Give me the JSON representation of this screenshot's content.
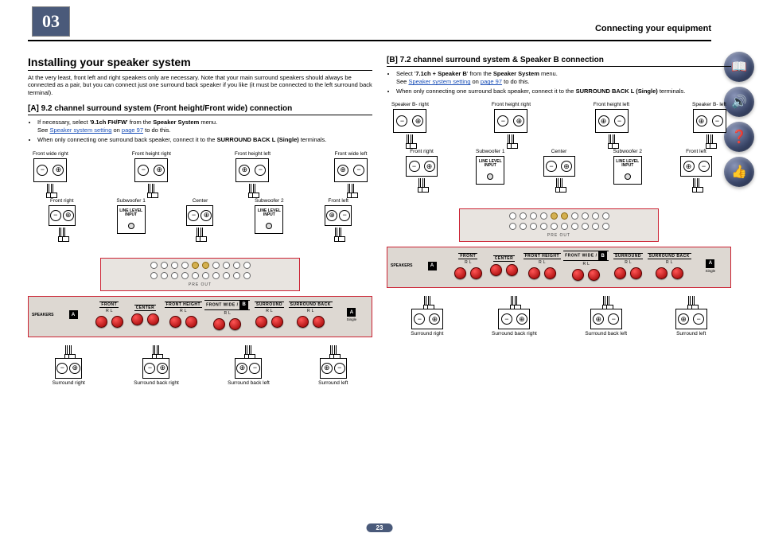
{
  "chapter": "03",
  "header": "Connecting your equipment",
  "page_number": "23",
  "side_icons": [
    "book-icon",
    "speaker-icon",
    "help-icon",
    "thumbs-up-icon"
  ],
  "left": {
    "title": "Installing your speaker system",
    "intro": "At the very least, front left and right speakers only are necessary. Note that your main surround speakers should always be connected as a pair, but you can connect just one surround back speaker if you like (it must be connected to the left surround back terminal).",
    "section_title": "[A] 9.2 channel surround system (Front height/Front wide) connection",
    "bullet1_pre": "If necessary, select '",
    "bullet1_bold1": "9.1ch FH/FW",
    "bullet1_mid": "' from the ",
    "bullet1_bold2": "Speaker System",
    "bullet1_post": " menu.",
    "bullet1_see": "See ",
    "bullet1_link": "Speaker system setting",
    "bullet1_on": " on ",
    "bullet1_page": "page 97",
    "bullet1_end": " to do this.",
    "bullet2_pre": "When only connecting one surround back speaker, connect it to the ",
    "bullet2_bold": "SURROUND BACK L (Single)",
    "bullet2_post": " terminals.",
    "labels": {
      "fw_r": "Front wide right",
      "fh_r": "Front height right",
      "fh_l": "Front height left",
      "fw_l": "Front wide left",
      "fr": "Front right",
      "sub1": "Subwoofer 1",
      "center": "Center",
      "sub2": "Subwoofer 2",
      "fl": "Front left",
      "sr": "Surround right",
      "sbr": "Surround back right",
      "sbl": "Surround back left",
      "sl": "Surround left",
      "lli": "LINE LEVEL INPUT",
      "preout": "PRE OUT"
    },
    "panel": {
      "speakers": "SPEAKERS",
      "front": "FRONT",
      "center": "CENTER",
      "fh": "FRONT HEIGHT",
      "fw": "FRONT WIDE /",
      "surround": "SURROUND",
      "sb": "SURROUND BACK",
      "r": "R",
      "l": "L",
      "a": "A",
      "b": "B",
      "single": "Single"
    }
  },
  "right": {
    "section_title": "[B] 7.2 channel surround system & Speaker B connection",
    "bullet1_pre": "Select '",
    "bullet1_bold1": "7.1ch + Speaker B",
    "bullet1_mid": "' from the ",
    "bullet1_bold2": "Speaker System",
    "bullet1_post": " menu.",
    "bullet1_see": "See ",
    "bullet1_link": "Speaker system setting",
    "bullet1_on": " on ",
    "bullet1_page": "page 97",
    "bullet1_end": " to do this.",
    "bullet2_pre": "When only connecting one surround back speaker, connect it to the ",
    "bullet2_bold": "SURROUND BACK L (Single)",
    "bullet2_post": " terminals.",
    "labels": {
      "sb_r": "Speaker B- right",
      "fh_r": "Front height right",
      "fh_l": "Front height left",
      "sb_l": "Speaker B- left",
      "fr": "Front right",
      "sub1": "Subwoofer 1",
      "center": "Center",
      "sub2": "Subwoofer 2",
      "fl": "Front left",
      "sr": "Surround right",
      "sbr": "Surround back right",
      "sbl": "Surround back left",
      "sl": "Surround left",
      "lli": "LINE LEVEL INPUT",
      "preout": "PRE OUT"
    }
  }
}
